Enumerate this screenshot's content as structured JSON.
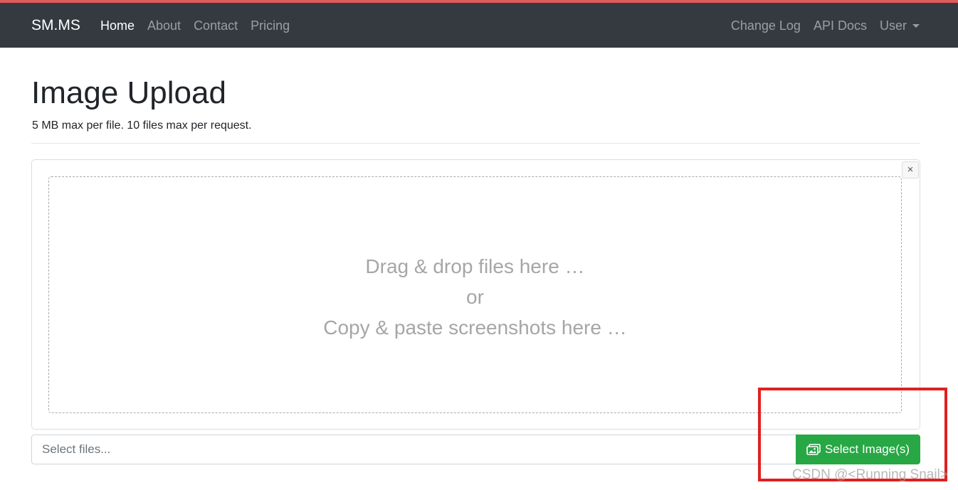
{
  "nav": {
    "brand": "SM.MS",
    "left_items": [
      {
        "label": "Home",
        "active": true
      },
      {
        "label": "About",
        "active": false
      },
      {
        "label": "Contact",
        "active": false
      },
      {
        "label": "Pricing",
        "active": false
      }
    ],
    "right_items": [
      {
        "label": "Change Log"
      },
      {
        "label": "API Docs"
      },
      {
        "label": "User"
      }
    ]
  },
  "page": {
    "title": "Image Upload",
    "subtitle": "5 MB max per file. 10 files max per request."
  },
  "upload": {
    "close_symbol": "×",
    "drop_line1": "Drag & drop files here …",
    "drop_line2": "or",
    "drop_line3": "Copy & paste screenshots here …",
    "input_placeholder": "Select files...",
    "button_label": "Select Image(s)",
    "button_icon": "images-icon"
  },
  "watermark": "CSDN @<Running Snail>",
  "colors": {
    "accent_top": "#e05a5a",
    "navbar_bg": "#343a40",
    "button_green": "#28a745",
    "highlight_red": "#e02020"
  }
}
